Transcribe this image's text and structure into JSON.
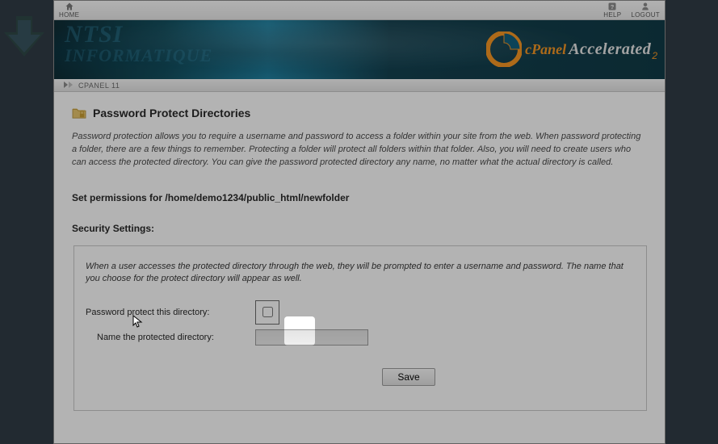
{
  "topbar": {
    "home": "HOME",
    "help": "HELP",
    "logout": "LOGOUT"
  },
  "breadcrumb": "CPANEL 11",
  "branding": {
    "cpanel": "cPanel",
    "accelerated": "Accelerated",
    "sub": "2"
  },
  "watermark": {
    "l1": "NTSI",
    "l2": "INFORMATIQUE"
  },
  "page": {
    "title": "Password Protect Directories",
    "description": "Password protection allows you to require a username and password to access a folder within your site from the web. When password protecting a folder, there are a few things to remember. Protecting a folder will protect all folders within that folder. Also, you will need to create users who can access the protected directory. You can give the password protected directory any name, no matter what the actual directory is called.",
    "permissions_heading": "Set permissions for /home/demo1234/public_html/newfolder",
    "security_heading": "Security Settings:",
    "security_note": "When a user accesses the protected directory through the web, they will be prompted to enter a username and password. The name that you choose for the protect directory will appear as well.",
    "protect_label": "Password protect this directory:",
    "name_label": "Name the protected directory:",
    "name_value": "",
    "save": "Save"
  }
}
